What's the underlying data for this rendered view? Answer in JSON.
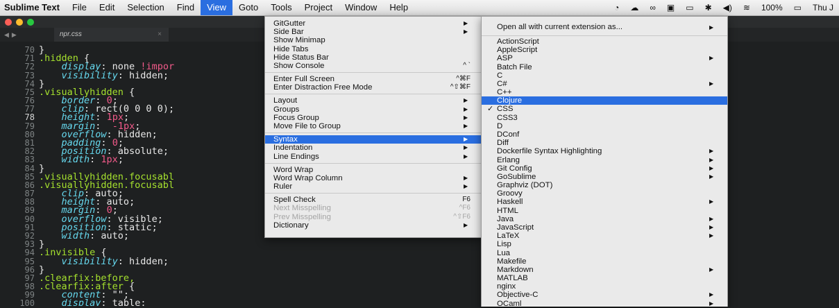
{
  "menubar": {
    "app": "Sublime Text",
    "items": [
      "File",
      "Edit",
      "Selection",
      "Find",
      "View",
      "Goto",
      "Tools",
      "Project",
      "Window",
      "Help"
    ],
    "active": "View",
    "status": {
      "battery": "100%",
      "clock": "Thu J"
    }
  },
  "tab": {
    "name": "npr.css",
    "close": "×"
  },
  "editor": {
    "lines": [
      {
        "n": "70",
        "tokens": [
          {
            "t": "}",
            "c": "punc"
          }
        ]
      },
      {
        "n": "71",
        "tokens": [
          {
            "t": ".hidden ",
            "c": "sel"
          },
          {
            "t": "{",
            "c": "punc"
          }
        ]
      },
      {
        "n": "72",
        "tokens": [
          {
            "t": "    "
          },
          {
            "t": "display",
            "c": "prop"
          },
          {
            "t": ": none ",
            "c": "val"
          },
          {
            "t": "!impor",
            "c": "imp"
          }
        ]
      },
      {
        "n": "73",
        "tokens": [
          {
            "t": "    "
          },
          {
            "t": "visibility",
            "c": "prop"
          },
          {
            "t": ": hidden;",
            "c": "val"
          }
        ]
      },
      {
        "n": "74",
        "tokens": [
          {
            "t": "}",
            "c": "punc"
          }
        ]
      },
      {
        "n": "75",
        "tokens": [
          {
            "t": ".visuallyhidden ",
            "c": "sel"
          },
          {
            "t": "{",
            "c": "punc"
          }
        ]
      },
      {
        "n": "76",
        "tokens": [
          {
            "t": "    "
          },
          {
            "t": "border",
            "c": "prop"
          },
          {
            "t": ": ",
            "c": "val"
          },
          {
            "t": "0",
            "c": "num"
          },
          {
            "t": ";",
            "c": "val"
          }
        ]
      },
      {
        "n": "77",
        "tokens": [
          {
            "t": "    "
          },
          {
            "t": "clip",
            "c": "prop"
          },
          {
            "t": ": rect(0 0 0 0);",
            "c": "val"
          }
        ]
      },
      {
        "n": "78",
        "hl": true,
        "tokens": [
          {
            "t": "    "
          },
          {
            "t": "height",
            "c": "prop"
          },
          {
            "t": ": ",
            "c": "val"
          },
          {
            "t": "1px",
            "c": "num"
          },
          {
            "t": ";",
            "c": "val"
          }
        ]
      },
      {
        "n": "79",
        "tokens": [
          {
            "t": "    "
          },
          {
            "t": "margin",
            "c": "prop"
          },
          {
            "t": ":  ",
            "c": "val"
          },
          {
            "t": "-1px",
            "c": "num"
          },
          {
            "t": ";",
            "c": "val"
          }
        ]
      },
      {
        "n": "80",
        "tokens": [
          {
            "t": "    "
          },
          {
            "t": "overflow",
            "c": "prop"
          },
          {
            "t": ": hidden;",
            "c": "val"
          }
        ]
      },
      {
        "n": "81",
        "tokens": [
          {
            "t": "    "
          },
          {
            "t": "padding",
            "c": "prop"
          },
          {
            "t": ": ",
            "c": "val"
          },
          {
            "t": "0",
            "c": "num"
          },
          {
            "t": ";",
            "c": "val"
          }
        ]
      },
      {
        "n": "82",
        "tokens": [
          {
            "t": "    "
          },
          {
            "t": "position",
            "c": "prop"
          },
          {
            "t": ": absolute;",
            "c": "val"
          }
        ]
      },
      {
        "n": "83",
        "tokens": [
          {
            "t": "    "
          },
          {
            "t": "width",
            "c": "prop"
          },
          {
            "t": ": ",
            "c": "val"
          },
          {
            "t": "1px",
            "c": "num"
          },
          {
            "t": ";",
            "c": "val"
          }
        ]
      },
      {
        "n": "84",
        "tokens": [
          {
            "t": "}",
            "c": "punc"
          }
        ]
      },
      {
        "n": "85",
        "tokens": [
          {
            "t": ".visuallyhidden.focusabl",
            "c": "sel"
          }
        ]
      },
      {
        "n": "86",
        "tokens": [
          {
            "t": ".visuallyhidden.focusabl",
            "c": "sel"
          }
        ]
      },
      {
        "n": "87",
        "tokens": [
          {
            "t": "    "
          },
          {
            "t": "clip",
            "c": "prop"
          },
          {
            "t": ": auto;",
            "c": "val"
          }
        ]
      },
      {
        "n": "88",
        "tokens": [
          {
            "t": "    "
          },
          {
            "t": "height",
            "c": "prop"
          },
          {
            "t": ": auto;",
            "c": "val"
          }
        ]
      },
      {
        "n": "89",
        "tokens": [
          {
            "t": "    "
          },
          {
            "t": "margin",
            "c": "prop"
          },
          {
            "t": ": ",
            "c": "val"
          },
          {
            "t": "0",
            "c": "num"
          },
          {
            "t": ";",
            "c": "val"
          }
        ]
      },
      {
        "n": "90",
        "tokens": [
          {
            "t": "    "
          },
          {
            "t": "overflow",
            "c": "prop"
          },
          {
            "t": ": visible;",
            "c": "val"
          }
        ]
      },
      {
        "n": "91",
        "tokens": [
          {
            "t": "    "
          },
          {
            "t": "position",
            "c": "prop"
          },
          {
            "t": ": static;",
            "c": "val"
          }
        ]
      },
      {
        "n": "92",
        "tokens": [
          {
            "t": "    "
          },
          {
            "t": "width",
            "c": "prop"
          },
          {
            "t": ": auto;",
            "c": "val"
          }
        ]
      },
      {
        "n": "93",
        "tokens": [
          {
            "t": "}",
            "c": "punc"
          }
        ]
      },
      {
        "n": "94",
        "tokens": [
          {
            "t": ".invisible ",
            "c": "sel"
          },
          {
            "t": "{",
            "c": "punc"
          }
        ]
      },
      {
        "n": "95",
        "tokens": [
          {
            "t": "    "
          },
          {
            "t": "visibility",
            "c": "prop"
          },
          {
            "t": ": hidden;",
            "c": "val"
          }
        ]
      },
      {
        "n": "96",
        "tokens": [
          {
            "t": "}",
            "c": "punc"
          }
        ]
      },
      {
        "n": "97",
        "tokens": [
          {
            "t": ".clearfix:before,",
            "c": "sel"
          }
        ]
      },
      {
        "n": "98",
        "tokens": [
          {
            "t": ".clearfix:after ",
            "c": "sel"
          },
          {
            "t": "{",
            "c": "punc"
          }
        ]
      },
      {
        "n": "99",
        "tokens": [
          {
            "t": "    "
          },
          {
            "t": "content",
            "c": "prop"
          },
          {
            "t": ": \"\";",
            "c": "val"
          }
        ]
      },
      {
        "n": "100",
        "tokens": [
          {
            "t": "    "
          },
          {
            "t": "display",
            "c": "prop"
          },
          {
            "t": ": table;",
            "c": "val"
          }
        ]
      }
    ]
  },
  "view_menu": {
    "items": [
      {
        "label": "GitGutter",
        "arrow": "▶"
      },
      {
        "label": "Side Bar",
        "arrow": "▶"
      },
      {
        "label": "Show Minimap"
      },
      {
        "label": "Hide Tabs"
      },
      {
        "label": "Hide Status Bar"
      },
      {
        "label": "Show Console",
        "shortcut": "^ `"
      },
      {
        "sep": true
      },
      {
        "label": "Enter Full Screen",
        "shortcut": "^⌘F"
      },
      {
        "label": "Enter Distraction Free Mode",
        "shortcut": "^⇧⌘F"
      },
      {
        "sep": true
      },
      {
        "label": "Layout",
        "arrow": "▶"
      },
      {
        "label": "Groups",
        "arrow": "▶"
      },
      {
        "label": "Focus Group",
        "arrow": "▶"
      },
      {
        "label": "Move File to Group",
        "arrow": "▶"
      },
      {
        "sep": true
      },
      {
        "label": "Syntax",
        "arrow": "▶",
        "highlighted": true
      },
      {
        "label": "Indentation",
        "arrow": "▶"
      },
      {
        "label": "Line Endings",
        "arrow": "▶"
      },
      {
        "sep": true
      },
      {
        "label": "Word Wrap"
      },
      {
        "label": "Word Wrap Column",
        "arrow": "▶"
      },
      {
        "label": "Ruler",
        "arrow": "▶"
      },
      {
        "sep": true
      },
      {
        "label": "Spell Check",
        "shortcut": "F6"
      },
      {
        "label": "Next Misspelling",
        "shortcut": "^F6",
        "disabled": true
      },
      {
        "label": "Prev Misspelling",
        "shortcut": "^⇧F6",
        "disabled": true
      },
      {
        "label": "Dictionary",
        "arrow": "▶"
      }
    ]
  },
  "syntax_menu": {
    "header": {
      "label": "Open all with current extension as...",
      "arrow": "▶"
    },
    "items": [
      {
        "label": "ActionScript"
      },
      {
        "label": "AppleScript"
      },
      {
        "label": "ASP",
        "arrow": "▶"
      },
      {
        "label": "Batch File"
      },
      {
        "label": "C"
      },
      {
        "label": "C#",
        "arrow": "▶"
      },
      {
        "label": "C++"
      },
      {
        "label": "Clojure",
        "highlighted": true
      },
      {
        "label": "CSS",
        "checked": true
      },
      {
        "label": "CSS3"
      },
      {
        "label": "D"
      },
      {
        "label": "DConf"
      },
      {
        "label": "Diff"
      },
      {
        "label": "Dockerfile Syntax Highlighting",
        "arrow": "▶"
      },
      {
        "label": "Erlang",
        "arrow": "▶"
      },
      {
        "label": "Git Config",
        "arrow": "▶"
      },
      {
        "label": "GoSublime",
        "arrow": "▶"
      },
      {
        "label": "Graphviz (DOT)"
      },
      {
        "label": "Groovy"
      },
      {
        "label": "Haskell",
        "arrow": "▶"
      },
      {
        "label": "HTML"
      },
      {
        "label": "Java",
        "arrow": "▶"
      },
      {
        "label": "JavaScript",
        "arrow": "▶"
      },
      {
        "label": "LaTeX",
        "arrow": "▶"
      },
      {
        "label": "Lisp"
      },
      {
        "label": "Lua"
      },
      {
        "label": "Makefile"
      },
      {
        "label": "Markdown",
        "arrow": "▶"
      },
      {
        "label": "MATLAB"
      },
      {
        "label": "nginx"
      },
      {
        "label": "Objective-C",
        "arrow": "▶"
      },
      {
        "label": "OCaml",
        "arrow": "▶"
      }
    ],
    "checkmark": "✓"
  },
  "colors": {
    "accent": "#2a6ee0",
    "editor_bg": "#1e2021"
  }
}
